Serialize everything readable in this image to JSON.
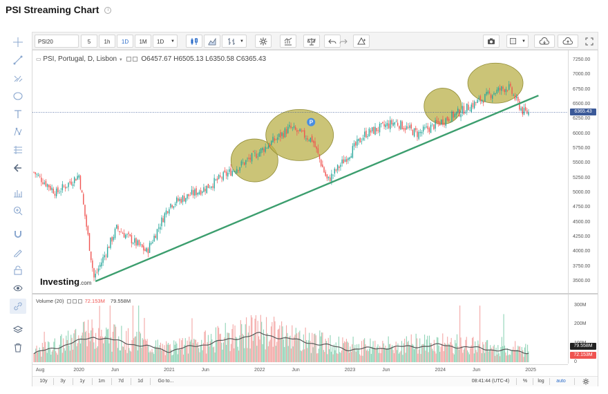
{
  "header": {
    "title": "PSI Streaming Chart",
    "info_icon": "info-icon"
  },
  "toolbar": {
    "symbol": "PSI20",
    "intervals": [
      "5",
      "1h",
      "1D",
      "1M",
      "1D"
    ],
    "selected_interval": "1D"
  },
  "legend": {
    "symbol_desc": "PSI, Portugal, D, Lisbon",
    "open": "O6457.67",
    "high": "H6505.13",
    "low": "L6350.58",
    "close": "C6365.43"
  },
  "volume_legend": {
    "label": "Volume (20)",
    "value1": "72.153M",
    "value2": "79.558M"
  },
  "logo": {
    "main": "Investing",
    "suffix": ".com"
  },
  "price_axis": [
    "7250.00",
    "7000.00",
    "6750.00",
    "6500.00",
    "6250.00",
    "6000.00",
    "5750.00",
    "5500.00",
    "5250.00",
    "5000.00",
    "4750.00",
    "4500.00",
    "4250.00",
    "4000.00",
    "3750.00",
    "3500.00"
  ],
  "current_price": "6365.43",
  "volume_axis": [
    "300M",
    "200M",
    "100M",
    "0"
  ],
  "volume_tags": {
    "ma": "79.558M",
    "vol": "72.153M"
  },
  "time_axis": [
    "Aug",
    "2020",
    "Jun",
    "2021",
    "Jun",
    "2022",
    "Jun",
    "2023",
    "Jun",
    "2024",
    "Jun",
    "2025"
  ],
  "bottom_bar": {
    "ranges": [
      "10y",
      "3y",
      "1y",
      "1m",
      "7d",
      "1d"
    ],
    "goto": "Go to...",
    "time": "08:41:44 (UTC-4)",
    "percent": "%",
    "log": "log",
    "auto": "auto"
  },
  "colors": {
    "up": "#26a69a",
    "down": "#ef5350",
    "trendline": "#3c9e6e",
    "highlight": "#b9b04a",
    "price_tag": "#3b5998",
    "accent": "#2a6bc8"
  },
  "chart_data": [
    {
      "type": "candlestick",
      "symbol": "PSI",
      "x": [
        "2019-07",
        "2019-10",
        "2020-01",
        "2020-03",
        "2020-06",
        "2020-10",
        "2021-01",
        "2021-06",
        "2021-12",
        "2022-05",
        "2022-08",
        "2022-10",
        "2023-03",
        "2023-07",
        "2023-10",
        "2024-04",
        "2024-08",
        "2024-10",
        "2024-12"
      ],
      "close": [
        5350,
        5000,
        5300,
        3550,
        4400,
        4000,
        4800,
        5100,
        5600,
        6100,
        5900,
        5200,
        6000,
        6200,
        6000,
        6400,
        6700,
        6800,
        6365
      ],
      "ylim": [
        3350,
        7400
      ],
      "annotations": [
        "trendline",
        "highlight-ellipses",
        "current-price-line"
      ],
      "grid": false,
      "scale": "linear"
    },
    {
      "type": "bar",
      "name": "Volume (20)",
      "x": [
        "2019-07",
        "2020-03",
        "2021-01",
        "2022-01",
        "2023-01",
        "2024-01",
        "2024-12"
      ],
      "values": [
        60,
        180,
        80,
        200,
        90,
        120,
        72.153
      ],
      "moving_average": 79.558,
      "ylabel": "",
      "ylim": [
        0,
        320
      ]
    }
  ]
}
